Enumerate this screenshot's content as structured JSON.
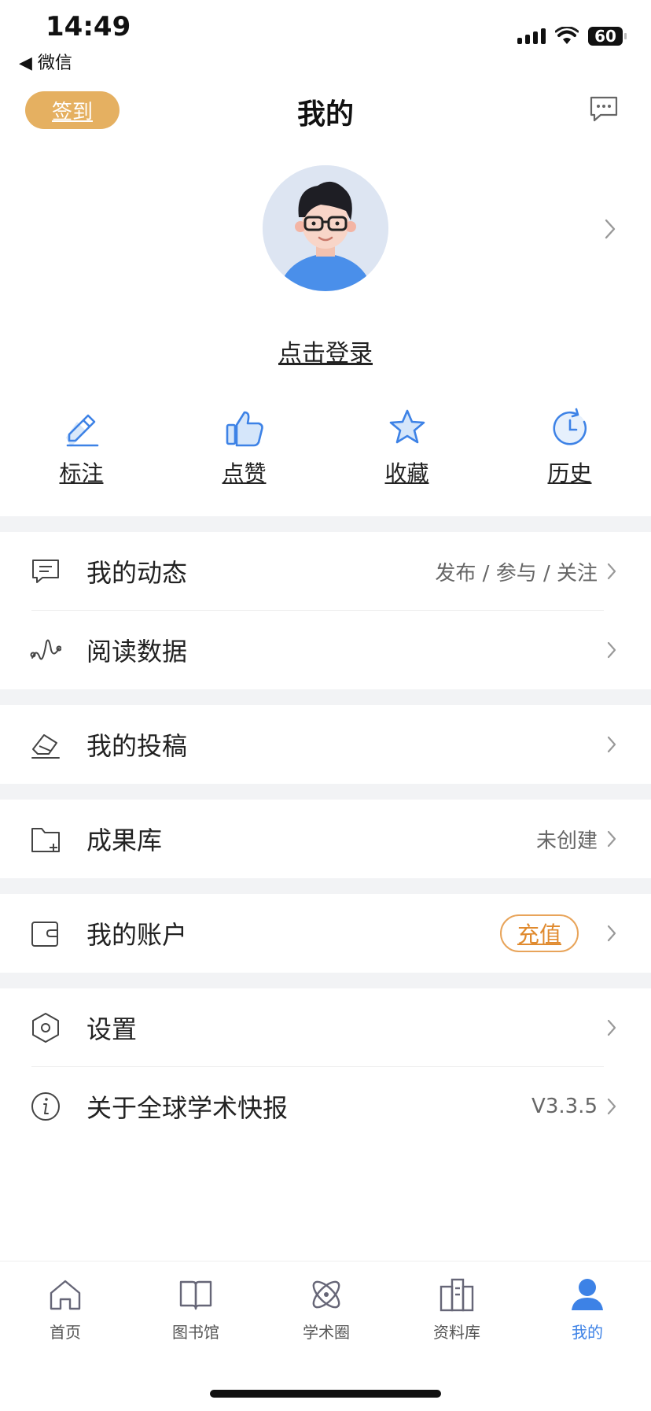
{
  "status_bar": {
    "time": "14:49",
    "back_label": "◀ 微信",
    "battery": "60"
  },
  "header": {
    "checkin_label": "签到",
    "title": "我的"
  },
  "profile": {
    "login_label": "点击登录"
  },
  "quick_actions": [
    {
      "label": "标注",
      "icon": "pencil-icon"
    },
    {
      "label": "点赞",
      "icon": "thumbs-up-icon"
    },
    {
      "label": "收藏",
      "icon": "star-icon"
    },
    {
      "label": "历史",
      "icon": "clock-icon"
    }
  ],
  "menu": {
    "activity": {
      "label": "我的动态",
      "value": "发布 / 参与 / 关注"
    },
    "reading_data": {
      "label": "阅读数据"
    },
    "submissions": {
      "label": "我的投稿"
    },
    "achievements": {
      "label": "成果库",
      "value": "未创建"
    },
    "account": {
      "label": "我的账户",
      "action": "充值"
    },
    "settings": {
      "label": "设置"
    },
    "about": {
      "label": "关于全球学术快报",
      "value": "V3.3.5"
    }
  },
  "tabs": [
    {
      "label": "首页",
      "icon": "home-icon"
    },
    {
      "label": "图书馆",
      "icon": "book-icon"
    },
    {
      "label": "学术圈",
      "icon": "atom-icon"
    },
    {
      "label": "资料库",
      "icon": "archive-icon"
    },
    {
      "label": "我的",
      "icon": "user-icon",
      "active": true
    }
  ],
  "colors": {
    "accent": "#3D82E6",
    "checkin": "#E5B061",
    "recharge": "#E08A2E",
    "separator": "#F2F3F5"
  }
}
